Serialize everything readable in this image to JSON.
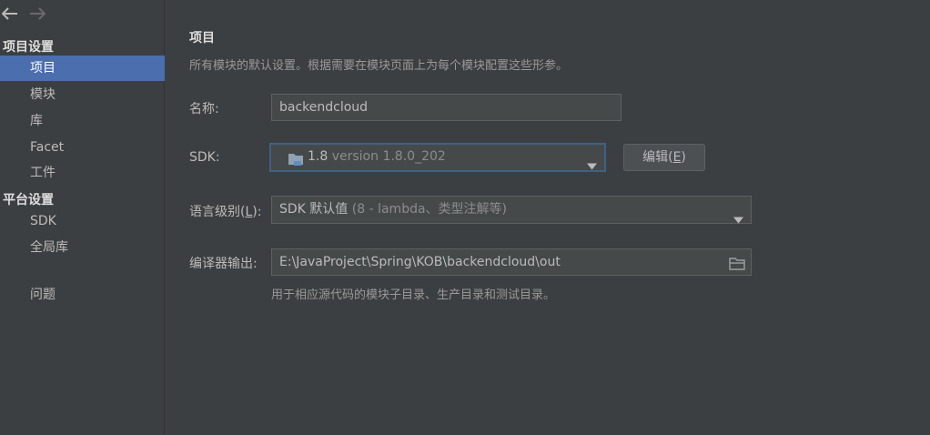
{
  "sidebar": {
    "project_settings_header": "项目设置",
    "project_items": [
      {
        "label": "项目",
        "selected": true
      },
      {
        "label": "模块"
      },
      {
        "label": "库"
      },
      {
        "label": "Facet"
      },
      {
        "label": "工件"
      }
    ],
    "platform_settings_header": "平台设置",
    "platform_items": [
      {
        "label": "SDK"
      },
      {
        "label": "全局库"
      }
    ],
    "problems_item": {
      "label": "问题"
    }
  },
  "main": {
    "title": "项目",
    "description": "所有模块的默认设置。根据需要在模块页面上为每个模块配置这些形参。",
    "name_label": "名称:",
    "name_value": "backendcloud",
    "sdk_label": "SDK:",
    "sdk_value_main": "1.8",
    "sdk_value_detail": "version 1.8.0_202",
    "edit_button_text": "编辑(",
    "edit_button_mnemonic": "E",
    "edit_button_close": ")",
    "lang_label_text": "语言级别(",
    "lang_label_mnemonic": "L",
    "lang_label_close": "):",
    "lang_value_main": "SDK 默认值",
    "lang_value_detail": "(8 - lambda、类型注解等)",
    "output_label": "编译器输出:",
    "output_value": "E:\\JavaProject\\Spring\\KOB\\backendcloud\\out",
    "output_hint": "用于相应源代码的模块子目录、生产目录和测试目录。"
  },
  "colors": {
    "background": "#3c3f41",
    "selection": "#4b6eaf",
    "field_bg": "#45494a",
    "focus_border": "#3d6185",
    "folder_icon": "#5d8fc4"
  },
  "icons": [
    "back-arrow-icon",
    "forward-arrow-icon",
    "folder-icon",
    "chevron-down-icon",
    "browse-folder-icon"
  ]
}
